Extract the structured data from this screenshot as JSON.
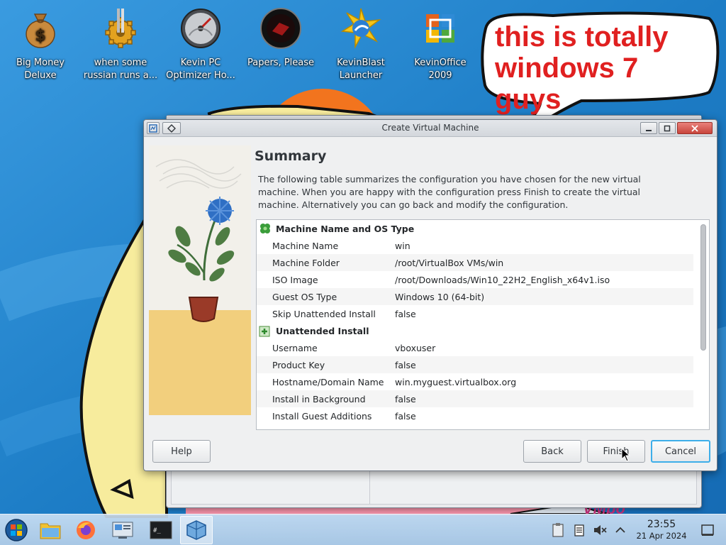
{
  "desktop": {
    "icons": [
      {
        "label": "Big Money Deluxe",
        "line1": "Big Money",
        "line2": "Deluxe",
        "icon": "money-bag-icon"
      },
      {
        "label": "when some russian runs a...",
        "line1": "when some",
        "line2": "russian runs a...",
        "icon": "gear-icon"
      },
      {
        "label": "Kevin PC Optimizer Ho...",
        "line1": "Kevin PC",
        "line2": "Optimizer Ho...",
        "icon": "speedometer-icon"
      },
      {
        "label": "Papers, Please",
        "line1": "Papers, Please",
        "line2": "",
        "icon": "papers-please-icon"
      },
      {
        "label": "KevinBlast Launcher",
        "line1": "KevinBlast",
        "line2": "Launcher",
        "icon": "kevinblast-icon"
      },
      {
        "label": "KevinOffice 2009",
        "line1": "KevinOffice",
        "line2": "2009",
        "icon": "office-icon"
      }
    ],
    "bubble": {
      "line1": "this is totally",
      "line2": "windows 7 guys",
      "color": "#e02020"
    }
  },
  "dialog": {
    "title": "Create Virtual Machine",
    "heading": "Summary",
    "description": "The following table summarizes the configuration you have chosen for the new virtual machine. When you are happy with the configuration press Finish to create the virtual machine. Alternatively you can go back and modify the configuration.",
    "groups": [
      {
        "title": "Machine Name and OS Type",
        "icon": "clover-icon",
        "rows": [
          {
            "key": "Machine Name",
            "value": "win"
          },
          {
            "key": "Machine Folder",
            "value": "/root/VirtualBox VMs/win"
          },
          {
            "key": "ISO Image",
            "value": "/root/Downloads/Win10_22H2_English_x64v1.iso"
          },
          {
            "key": "Guest OS Type",
            "value": "Windows 10 (64-bit)"
          },
          {
            "key": "Skip Unattended Install",
            "value": "false"
          }
        ]
      },
      {
        "title": "Unattended Install",
        "icon": "add-green-icon",
        "rows": [
          {
            "key": "Username",
            "value": "vboxuser"
          },
          {
            "key": "Product Key",
            "value": "false"
          },
          {
            "key": "Hostname/Domain Name",
            "value": "win.myguest.virtualbox.org"
          },
          {
            "key": "Install in Background",
            "value": "false"
          },
          {
            "key": "Install Guest Additions",
            "value": "false"
          }
        ]
      }
    ],
    "buttons": {
      "help": "Help",
      "back": "Back",
      "finish": "Finish",
      "cancel": "Cancel"
    }
  },
  "taskbar": {
    "apps": [
      "start-orb-icon",
      "file-manager-icon",
      "firefox-icon",
      "network-settings-icon",
      "terminal-icon",
      "virtualbox-icon"
    ],
    "clock": {
      "time": "23:55",
      "date": "21 Apr 2024"
    }
  },
  "colors": {
    "accent": "#3daee9",
    "desktop": "#1a78c2",
    "taskbar": "#c8dcf0"
  }
}
